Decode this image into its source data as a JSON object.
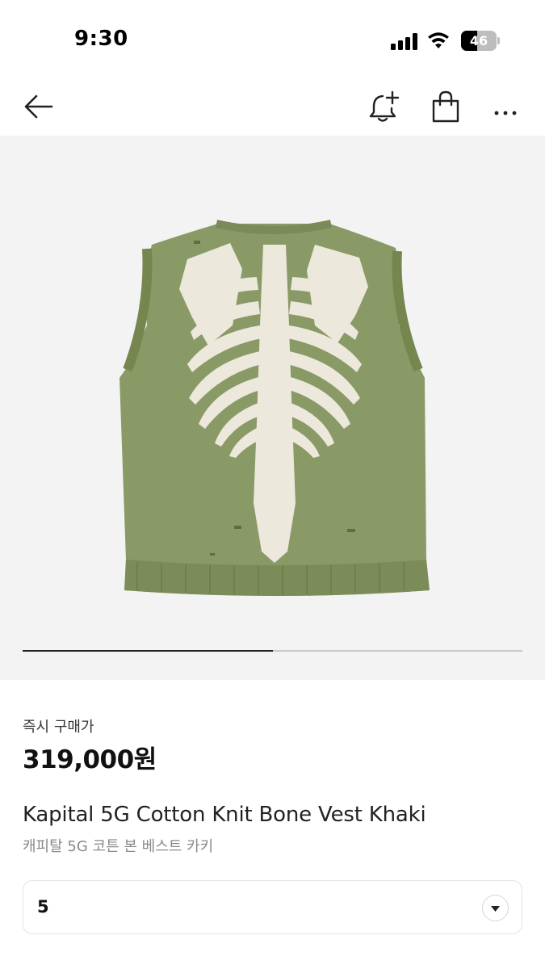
{
  "status_bar": {
    "time": "9:30",
    "battery_level": "46",
    "icons": [
      "signal-icon",
      "wifi-icon",
      "battery-icon"
    ]
  },
  "nav": {
    "icons": [
      "back-arrow-icon",
      "bell-plus-icon",
      "shopping-bag-icon",
      "more-dots-icon"
    ]
  },
  "gallery": {
    "image": "khaki-knit-vest-skeleton-back",
    "image_colors": {
      "knit": "#8a9a66",
      "bone": "#ece8dc",
      "background": "#f3f3f3"
    },
    "progress_fraction": 0.5
  },
  "product": {
    "price_label": "즉시 구매가",
    "price": "319,000원",
    "title_en": "Kapital 5G Cotton Knit Bone Vest Khaki",
    "title_ko": "캐피탈 5G 코튼 본 베스트 카키"
  },
  "size_selector": {
    "selected": "5",
    "icon": "chevron-down-icon"
  }
}
